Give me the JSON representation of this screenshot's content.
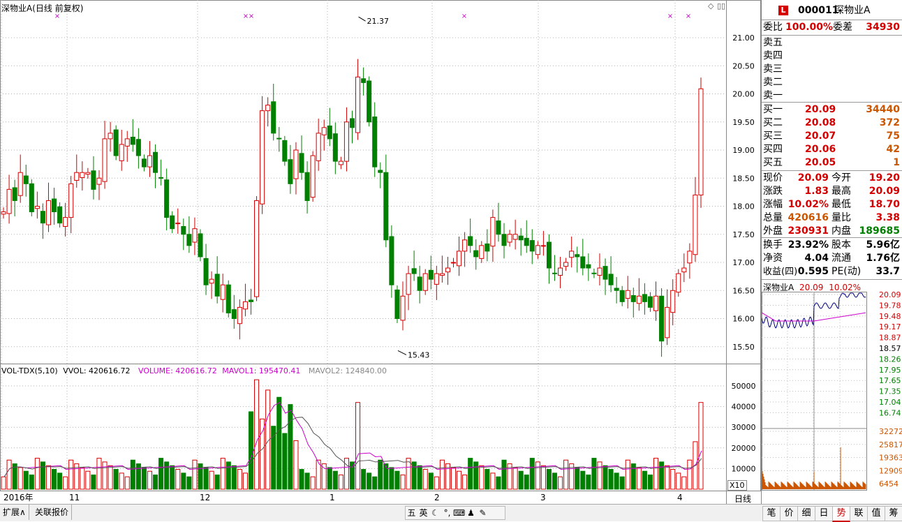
{
  "main_chart": {
    "title": "深物业A(日线 前复权)",
    "price_ticks": [
      "21.00",
      "20.50",
      "20.00",
      "19.50",
      "19.00",
      "18.50",
      "18.00",
      "17.50",
      "17.00",
      "16.50",
      "16.00",
      "15.50"
    ],
    "high_label": "21.37",
    "low_label": "15.43",
    "x_labels": [
      "2016年",
      "11",
      "12",
      "1",
      "2",
      "3",
      "4"
    ],
    "period_label": "日线",
    "colors": {
      "up": "#d40000",
      "down": "#008000",
      "ma1": "#cc00cc",
      "ma2": "#555555"
    }
  },
  "volume_chart": {
    "title": "VOL-TDX(5,10)",
    "vvol": "VVOL: 420616.72",
    "volume": "VOLUME: 420616.72",
    "mavol1": "MAVOL1: 195470.41",
    "mavol2": "MAVOL2: 124840.00",
    "ticks": [
      "50000",
      "40000",
      "30000",
      "20000",
      "10000"
    ],
    "multiplier": "X10"
  },
  "quote": {
    "code": "000011",
    "name": "深物业A",
    "wei_bi_label": "委比",
    "wei_bi": "100.00%",
    "wei_cha_label": "委差",
    "wei_cha": "34930",
    "sell": [
      {
        "label": "卖五"
      },
      {
        "label": "卖四"
      },
      {
        "label": "卖三"
      },
      {
        "label": "卖二"
      },
      {
        "label": "卖一"
      }
    ],
    "buy": [
      {
        "label": "买一",
        "price": "20.09",
        "vol": "34440"
      },
      {
        "label": "买二",
        "price": "20.08",
        "vol": "372"
      },
      {
        "label": "买三",
        "price": "20.07",
        "vol": "75"
      },
      {
        "label": "买四",
        "price": "20.06",
        "vol": "42"
      },
      {
        "label": "买五",
        "price": "20.05",
        "vol": "1"
      }
    ],
    "stats": [
      {
        "l1": "现价",
        "v1": "20.09",
        "l2": "今开",
        "v2": "19.20"
      },
      {
        "l1": "涨跌",
        "v1": "1.83",
        "l2": "最高",
        "v2": "20.09"
      },
      {
        "l1": "涨幅",
        "v1": "10.02%",
        "l2": "最低",
        "v2": "18.70"
      },
      {
        "l1": "总量",
        "v1": "420616",
        "l2": "量比",
        "v2": "3.38"
      },
      {
        "l1": "外盘",
        "v1": "230931",
        "l2": "内盘",
        "v2": "189685"
      }
    ],
    "finance": [
      {
        "l1": "换手",
        "v1": "23.92%",
        "l2": "股本",
        "v2": "5.96亿"
      },
      {
        "l1": "净资",
        "v1": "4.04",
        "l2": "流通",
        "v2": "1.76亿"
      },
      {
        "l1": "收益(四)",
        "v1": "0.595",
        "l2": "PE(动)",
        "v2": "33.7"
      }
    ]
  },
  "mini_chart": {
    "title": "深物业A",
    "price": "20.09",
    "change": "10.02%",
    "price_ticks": [
      "20.09",
      "19.78",
      "19.48",
      "19.17",
      "18.87",
      "18.57",
      "18.26",
      "17.95",
      "17.65",
      "17.35",
      "17.04",
      "16.74"
    ],
    "vol_ticks": [
      "32272",
      "25817",
      "19363",
      "12909",
      "6454"
    ]
  },
  "bottom": {
    "tabs": [
      "扩展∧",
      "关联报价"
    ],
    "right_tabs": [
      "笔",
      "价",
      "细",
      "日",
      "势",
      "联",
      "值",
      "筹"
    ],
    "active_right_tab": "势",
    "ime": [
      "五",
      "英",
      "☾",
      "°,",
      "⌨",
      "♟",
      "✎"
    ]
  }
}
